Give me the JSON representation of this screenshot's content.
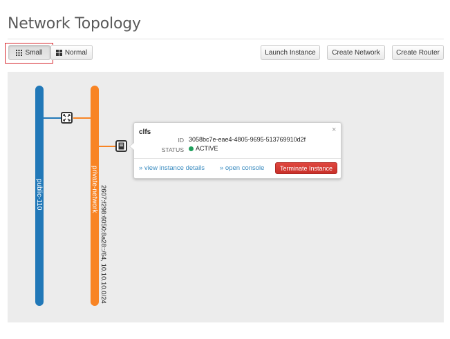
{
  "page": {
    "title": "Network Topology"
  },
  "toolbar": {
    "small_label": "Small",
    "normal_label": "Normal",
    "launch_instance_label": "Launch Instance",
    "create_network_label": "Create Network",
    "create_router_label": "Create Router"
  },
  "topology": {
    "networks": [
      {
        "name": "public-110",
        "color": "#2178b8",
        "cidr": ""
      },
      {
        "name": "private-network",
        "color": "#f88424",
        "cidr": "2607:f298:6050:8a28::/64, 10.10.10.0/24"
      }
    ],
    "router": {
      "icon": "router-icon"
    },
    "instance": {
      "icon": "server-icon"
    }
  },
  "popup": {
    "name": "clfs",
    "close_symbol": "×",
    "id_label": "ID",
    "id_value": "3058bc7e-eae4-4805-9695-513769910d2f",
    "status_label": "STATUS",
    "status_value": "ACTIVE",
    "status_color": "#1f9f5c",
    "view_details_label": "» view instance details",
    "open_console_label": "» open console",
    "terminate_label": "Terminate Instance"
  }
}
